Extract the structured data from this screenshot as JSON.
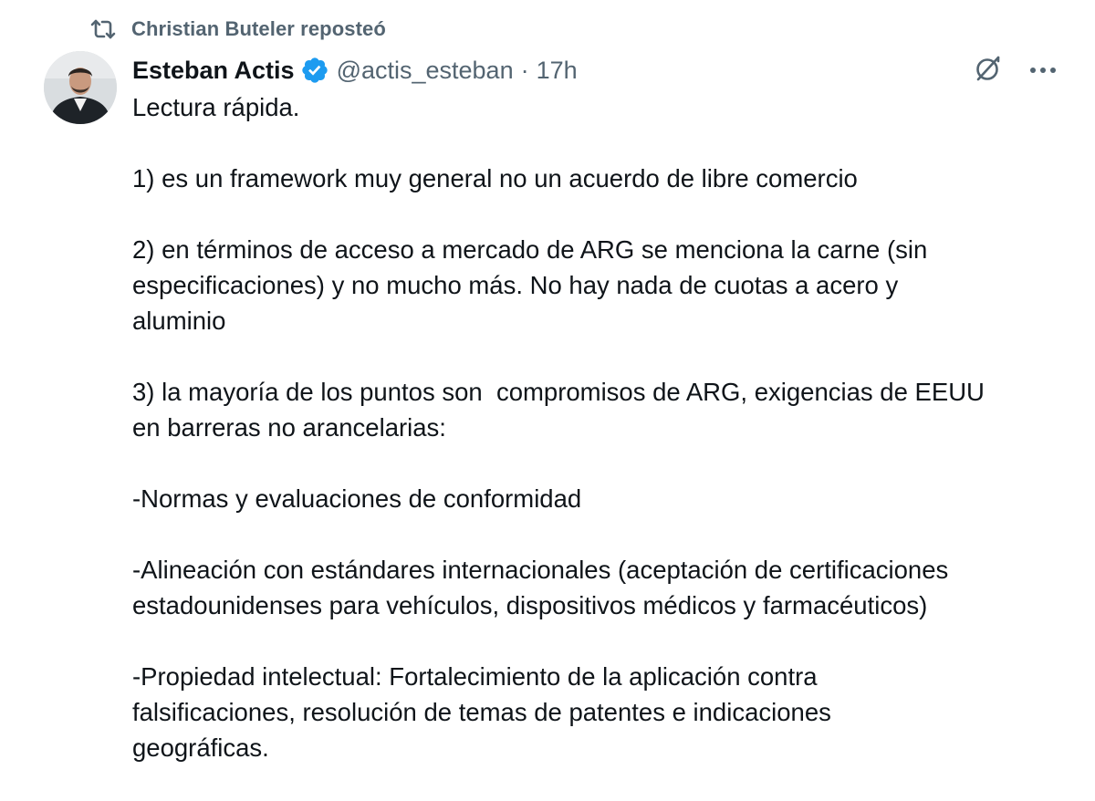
{
  "repost": {
    "icon": "repost-icon",
    "text": "Christian Buteler reposteó"
  },
  "author": {
    "name": "Esteban Actis",
    "verified_icon": "verified-badge-icon",
    "handle": "@actis_esteban",
    "separator": "·",
    "time": "17h",
    "avatar_icon": "avatar"
  },
  "actions": {
    "grok_icon": "grok-icon",
    "more_icon": "more-icon"
  },
  "tweet": {
    "paragraphs": [
      "Lectura rápida.",
      "1) es un framework muy general no un acuerdo de libre comercio",
      "2) en términos de acceso a mercado de ARG se menciona la carne (sin\nespecificaciones) y no mucho más. No hay nada de cuotas a acero y\naluminio",
      "3) la mayoría de los puntos son  compromisos de ARG, exigencias de EEUU\nen barreras no arancelarias:",
      "-Normas y evaluaciones de conformidad",
      "-Alineación con estándares internacionales (aceptación de certificaciones\nestadounidenses para vehículos, dispositivos médicos y farmacéuticos)",
      "-Propiedad intelectual: Fortalecimiento de la aplicación contra\nfalsificaciones, resolución de temas de patentes e indicaciones\ngeográficas."
    ]
  },
  "colors": {
    "text": "#0f1419",
    "secondary": "#536471",
    "verified": "#1d9bf0"
  }
}
